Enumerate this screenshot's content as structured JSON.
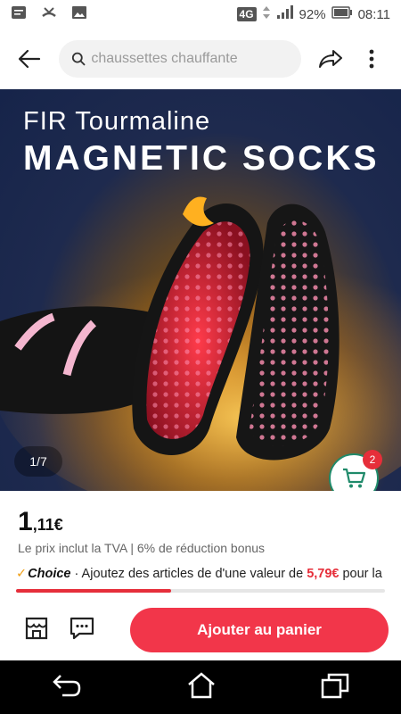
{
  "status_bar": {
    "network": "4G",
    "battery": "92%",
    "time": "08:11"
  },
  "search": {
    "placeholder": "chaussettes chauffante"
  },
  "hero": {
    "subtitle": "FIR Tourmaline",
    "title": "MAGNETIC SOCKS",
    "image_counter": "1/7",
    "cart_count": "2"
  },
  "price": {
    "integer": "1",
    "decimal": ",11€",
    "note": "Le prix inclut la TVA | 6% de réduction bonus"
  },
  "choice": {
    "tag": "Choice",
    "text_before": "· Ajoutez des articles de d'une valeur de",
    "amount": "5,79€",
    "text_after": "pour la",
    "progress": 0.42
  },
  "actions": {
    "add_to_cart": "Ajouter au panier"
  },
  "colors": {
    "accent": "#f2364a",
    "price_red": "#e62e3a",
    "cart_green": "#1f8a6a"
  }
}
